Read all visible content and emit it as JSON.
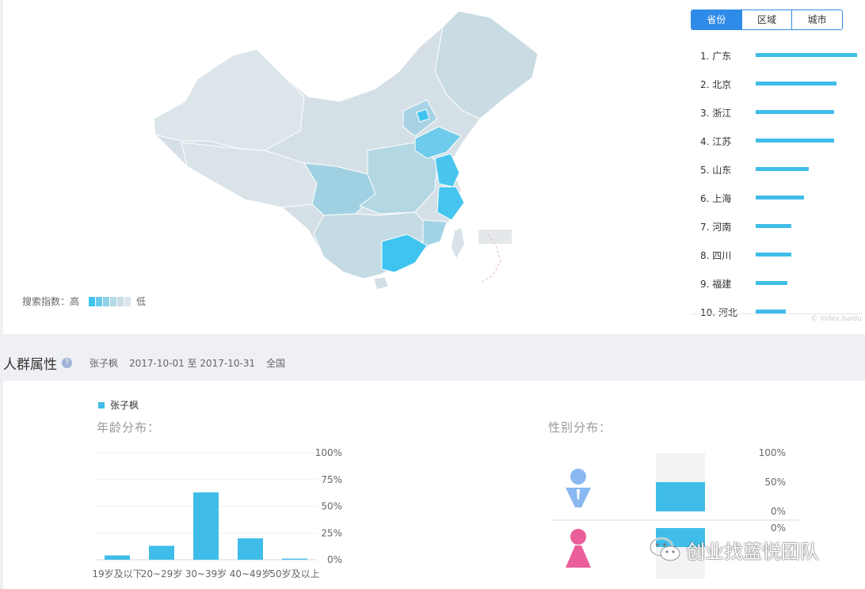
{
  "map": {
    "legend_label": "搜索指数：高",
    "legend_low": "低",
    "legend_colors": [
      "#3fc4ef",
      "#6bcbec",
      "#92d2e7",
      "#b3d9e5",
      "#cbdde4",
      "#dde5ea"
    ],
    "watermark": "© index.baidu"
  },
  "tabs": [
    {
      "label": "省份",
      "active": true
    },
    {
      "label": "区域",
      "active": false
    },
    {
      "label": "城市",
      "active": false
    }
  ],
  "ranking": [
    {
      "label": "1.  广东",
      "value": 100
    },
    {
      "label": "2.  北京",
      "value": 80
    },
    {
      "label": "3.  浙江",
      "value": 77
    },
    {
      "label": "4.  江苏",
      "value": 77
    },
    {
      "label": "5.  山东",
      "value": 52
    },
    {
      "label": "6.  上海",
      "value": 48
    },
    {
      "label": "7.  河南",
      "value": 35
    },
    {
      "label": "8.  四川",
      "value": 35
    },
    {
      "label": "9.  福建",
      "value": 31
    },
    {
      "label": "10. 河北",
      "value": 30
    }
  ],
  "section": {
    "title": "人群属性",
    "help": "?",
    "keyword": "张子枫",
    "date_range": "2017-10-01 至 2017-10-31",
    "region": "全国"
  },
  "series_legend": "张子枫",
  "colors": {
    "accent": "#3fbde8",
    "male": "#8ab8f0",
    "female": "#ea5f9a",
    "tab_active": "#2f8be8"
  },
  "chart_data": [
    {
      "type": "bar",
      "title": "年龄分布：",
      "categories": [
        "19岁及以下",
        "20~29岁",
        "30~39岁",
        "40~49岁",
        "50岁及以上"
      ],
      "series": [
        {
          "name": "张子枫",
          "values": [
            4,
            13,
            63,
            20,
            1
          ]
        }
      ],
      "ylim": [
        0,
        100
      ],
      "yticks": [
        "100%",
        "75%",
        "50%",
        "25%",
        "0%"
      ]
    },
    {
      "type": "bar",
      "title": "性别分布：",
      "categories": [
        "男",
        "女"
      ],
      "series": [
        {
          "name": "张子枫",
          "values": [
            50,
            50
          ]
        }
      ],
      "ylim": [
        0,
        100
      ],
      "male_ticks": [
        "100%",
        "50%",
        "0%"
      ],
      "female_ticks": [
        "0%"
      ],
      "male_icon": "male-person-icon",
      "female_icon": "female-person-icon"
    }
  ],
  "watermark": {
    "icon": "wechat-icon",
    "text": "创业找蓝悦团队"
  }
}
